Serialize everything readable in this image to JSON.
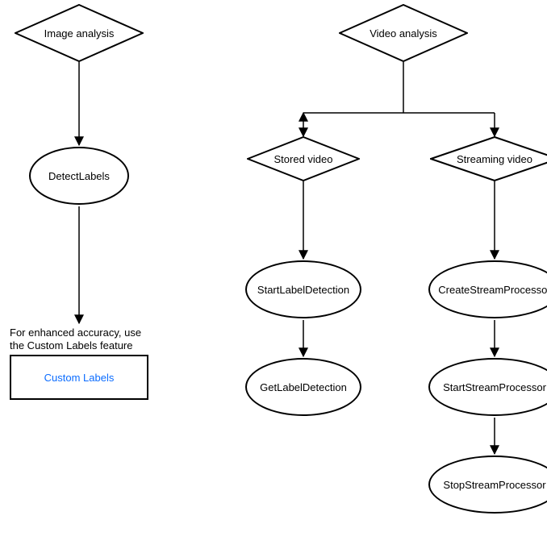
{
  "diagram": {
    "image_analysis": {
      "label": "Image analysis",
      "detect_labels": "DetectLabels",
      "note": "For enhanced accuracy, use the Custom Labels feature",
      "custom_labels_link": "Custom Labels"
    },
    "video_analysis": {
      "label": "Video analysis",
      "stored_video": {
        "label": "Stored video",
        "start_label_detection": "StartLabelDetection",
        "get_label_detection": "GetLabelDetection"
      },
      "streaming_video": {
        "label": "Streaming video",
        "create_stream_processor": "CreateStreamProcessor",
        "start_stream_processor": "StartStreamProcessor",
        "stop_stream_processor": "StopStreamProcessor"
      }
    }
  }
}
